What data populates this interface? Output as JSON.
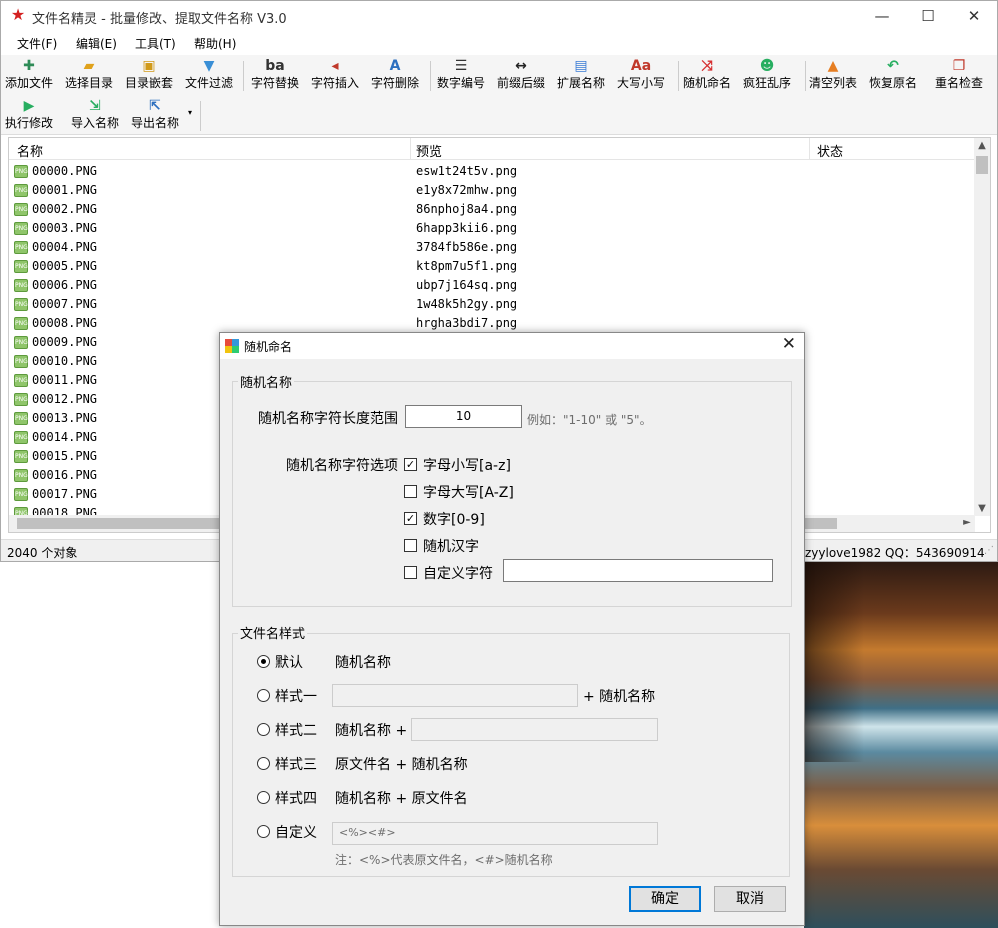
{
  "window": {
    "title": "文件名精灵 - 批量修改、提取文件名称  V3.0",
    "minimize": "—",
    "maximize": "☐",
    "close": "✕"
  },
  "menu": [
    "文件(F)",
    "编辑(E)",
    "工具(T)",
    "帮助(H)"
  ],
  "toolbar": {
    "row1": [
      {
        "label": "添加文件",
        "icon": "add-file-icon",
        "glyph": "✚",
        "color": "#2e8b57"
      },
      {
        "label": "选择目录",
        "icon": "folder-icon",
        "glyph": "▰",
        "color": "#e0a21c"
      },
      {
        "label": "目录嵌套",
        "icon": "nested-folder-icon",
        "glyph": "▣",
        "color": "#d19a1a"
      },
      {
        "label": "文件过滤",
        "icon": "filter-icon",
        "glyph": "▼",
        "color": "#3a8fd6"
      },
      {
        "label": "字符替换",
        "icon": "replace-icon",
        "glyph": "ba",
        "color": "#333333"
      },
      {
        "label": "字符插入",
        "icon": "insert-icon",
        "glyph": "◂",
        "color": "#c0392b"
      },
      {
        "label": "字符删除",
        "icon": "delete-char-icon",
        "glyph": "A",
        "color": "#2c6fbf"
      },
      {
        "label": "数字编号",
        "icon": "numbering-icon",
        "glyph": "☰",
        "color": "#333333"
      },
      {
        "label": "前缀后缀",
        "icon": "prefix-suffix-icon",
        "glyph": "↔",
        "color": "#222222"
      },
      {
        "label": "扩展名称",
        "icon": "extension-icon",
        "glyph": "▤",
        "color": "#3a7bd5"
      },
      {
        "label": "大写小写",
        "icon": "case-icon",
        "glyph": "Aa",
        "color": "#c0392b"
      },
      {
        "label": "随机命名",
        "icon": "shuffle-icon",
        "glyph": "⤨",
        "color": "#d63031"
      },
      {
        "label": "疯狂乱序",
        "icon": "crazy-sort-icon",
        "glyph": "☻",
        "color": "#27ae60"
      },
      {
        "label": "清空列表",
        "icon": "clear-list-icon",
        "glyph": "▲",
        "color": "#e67e22"
      },
      {
        "label": "恢复原名",
        "icon": "undo-icon",
        "glyph": "↶",
        "color": "#27ae60"
      },
      {
        "label": "重名检查",
        "icon": "duplicate-check-icon",
        "glyph": "❐",
        "color": "#c0392b"
      }
    ],
    "row2": [
      {
        "label": "执行修改",
        "icon": "play-icon",
        "glyph": "▶",
        "color": "#27ae60"
      },
      {
        "label": "导入名称",
        "icon": "import-icon",
        "glyph": "⇲",
        "color": "#27ae60"
      },
      {
        "label": "导出名称",
        "icon": "export-icon",
        "glyph": "⇱",
        "color": "#2c6fbf"
      }
    ],
    "dropdown_arrow": "▾"
  },
  "list": {
    "columns": [
      "名称",
      "预览",
      "状态"
    ],
    "file_icon_text": "PNG",
    "rows": [
      {
        "name": "00000.PNG",
        "preview": "esw1t24t5v.png"
      },
      {
        "name": "00001.PNG",
        "preview": "e1y8x72mhw.png"
      },
      {
        "name": "00002.PNG",
        "preview": "86nphoj8a4.png"
      },
      {
        "name": "00003.PNG",
        "preview": "6happ3kii6.png"
      },
      {
        "name": "00004.PNG",
        "preview": "3784fb586e.png"
      },
      {
        "name": "00005.PNG",
        "preview": "kt8pm7u5f1.png"
      },
      {
        "name": "00006.PNG",
        "preview": "ubp7j164sq.png"
      },
      {
        "name": "00007.PNG",
        "preview": "1w48k5h2gy.png"
      },
      {
        "name": "00008.PNG",
        "preview": "hrgha3bdi7.png"
      },
      {
        "name": "00009.PNG",
        "preview": ""
      },
      {
        "name": "00010.PNG",
        "preview": ""
      },
      {
        "name": "00011.PNG",
        "preview": ""
      },
      {
        "name": "00012.PNG",
        "preview": ""
      },
      {
        "name": "00013.PNG",
        "preview": ""
      },
      {
        "name": "00014.PNG",
        "preview": ""
      },
      {
        "name": "00015.PNG",
        "preview": ""
      },
      {
        "name": "00016.PNG",
        "preview": ""
      },
      {
        "name": "00017.PNG",
        "preview": ""
      },
      {
        "name": "00018.PNG",
        "preview": ""
      }
    ]
  },
  "status": {
    "count": "2040 个对象",
    "contact": "zyylove1982   QQ：543690914"
  },
  "dialog": {
    "title": "随机命名",
    "close": "✕",
    "group1_title": "随机名称",
    "length_label": "随机名称字符长度范围",
    "length_value": "10",
    "length_hint": "例如：\"1-10\" 或 \"5\"。",
    "options_label": "随机名称字符选项",
    "options": [
      {
        "label": "字母小写[a-z]",
        "checked": true
      },
      {
        "label": "字母大写[A-Z]",
        "checked": false
      },
      {
        "label": "数字[0-9]",
        "checked": true
      },
      {
        "label": "随机汉字",
        "checked": false
      },
      {
        "label": "自定义字符",
        "checked": false
      }
    ],
    "custom_chars_value": "",
    "group2_title": "文件名样式",
    "styles": {
      "default_label": "默认",
      "default_desc": "随机名称",
      "s1_label": "样式一",
      "s1_suffix": "+ 随机名称",
      "s2_label": "样式二",
      "s2_prefix": "随机名称 +",
      "s3_label": "样式三",
      "s3_desc": "原文件名 + 随机名称",
      "s4_label": "样式四",
      "s4_desc": "随机名称 + 原文件名",
      "custom_label": "自定义",
      "custom_value": "<%><#>",
      "note": "注：<%>代表原文件名，<#>随机名称"
    },
    "selected_style": "default",
    "ok": "确定",
    "cancel": "取消"
  }
}
